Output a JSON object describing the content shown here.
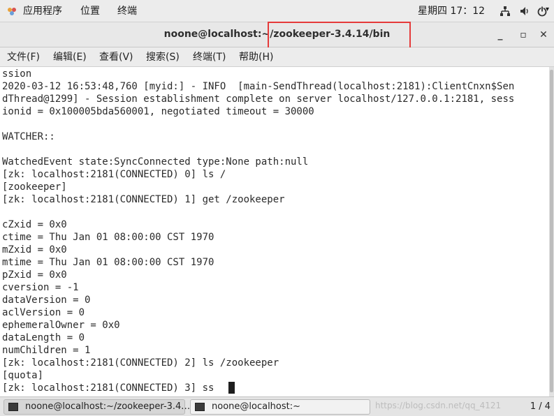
{
  "topbar": {
    "apps": "应用程序",
    "places": "位置",
    "terminal": "终端",
    "clock": "星期四 17：12"
  },
  "window": {
    "title": "noone@localhost:~/zookeeper-3.4.14/bin",
    "minimize": "_",
    "maximize": "▫",
    "close": "✕"
  },
  "menu": [
    "文件(F)",
    "编辑(E)",
    "查看(V)",
    "搜索(S)",
    "终端(T)",
    "帮助(H)"
  ],
  "terminal_lines": [
    "ssion",
    "2020-03-12 16:53:48,760 [myid:] - INFO  [main-SendThread(localhost:2181):ClientCnxn$Sen",
    "dThread@1299] - Session establishment complete on server localhost/127.0.0.1:2181, sess",
    "ionid = 0x100005bda560001, negotiated timeout = 30000",
    "",
    "WATCHER::",
    "",
    "WatchedEvent state:SyncConnected type:None path:null",
    "[zk: localhost:2181(CONNECTED) 0] ls /",
    "[zookeeper]",
    "[zk: localhost:2181(CONNECTED) 1] get /zookeeper",
    "",
    "cZxid = 0x0",
    "ctime = Thu Jan 01 08:00:00 CST 1970",
    "mZxid = 0x0",
    "mtime = Thu Jan 01 08:00:00 CST 1970",
    "pZxid = 0x0",
    "cversion = -1",
    "dataVersion = 0",
    "aclVersion = 0",
    "ephemeralOwner = 0x0",
    "dataLength = 0",
    "numChildren = 1",
    "[zk: localhost:2181(CONNECTED) 2] ls /zookeeper",
    "[quota]",
    "[zk: localhost:2181(CONNECTED) 3] ss"
  ],
  "taskbar": {
    "tasks": [
      "noone@localhost:~/zookeeper-3.4.…",
      "noone@localhost:~"
    ],
    "watermark": "https://blog.csdn.net/qq_4121",
    "pager": "1 / 4"
  },
  "colors": {
    "highlight": "#e53a3a"
  }
}
